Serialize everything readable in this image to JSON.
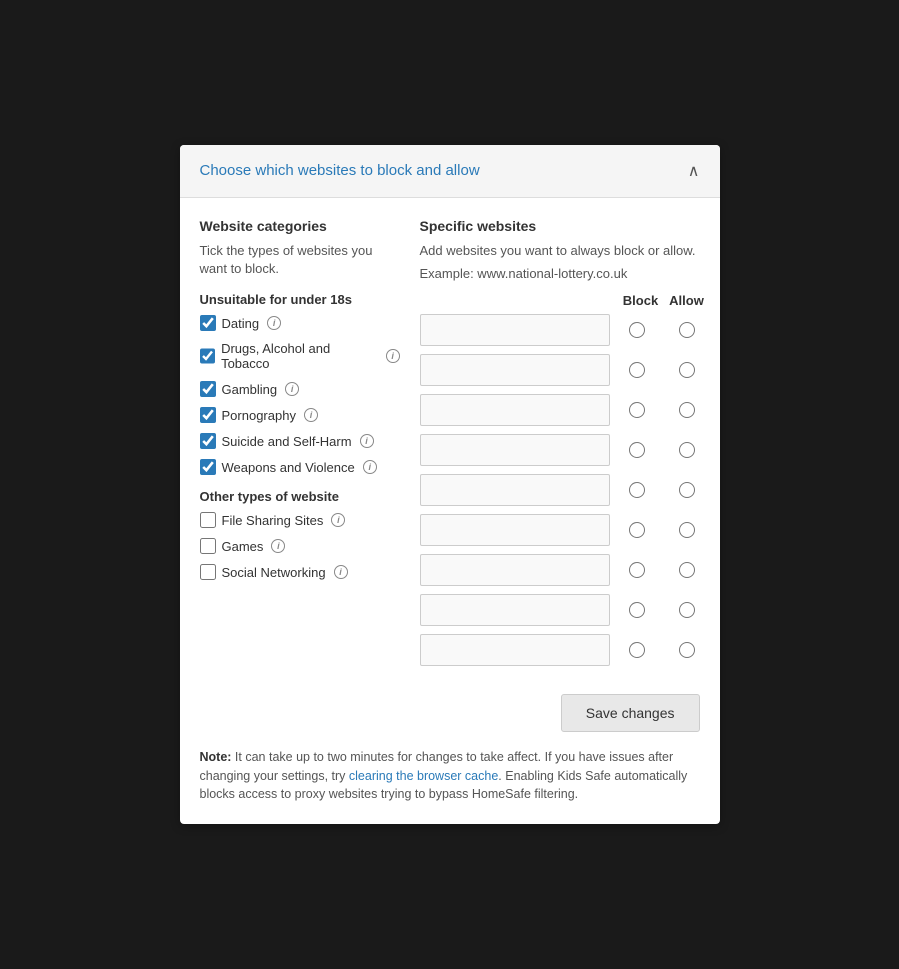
{
  "header": {
    "title": "Choose which websites to block and allow",
    "chevron": "∧"
  },
  "left_col": {
    "section_title": "Website categories",
    "section_desc": "Tick the types of websites you want to block.",
    "group1_title": "Unsuitable for under 18s",
    "group2_title": "Other types of website",
    "categories_under18": [
      {
        "label": "Dating",
        "checked": true
      },
      {
        "label": "Drugs, Alcohol and Tobacco",
        "checked": true
      },
      {
        "label": "Gambling",
        "checked": true
      },
      {
        "label": "Pornography",
        "checked": true
      },
      {
        "label": "Suicide and Self-Harm",
        "checked": true
      },
      {
        "label": "Weapons and Violence",
        "checked": true
      }
    ],
    "categories_other": [
      {
        "label": "File Sharing Sites",
        "checked": false
      },
      {
        "label": "Games",
        "checked": false
      },
      {
        "label": "Social Networking",
        "checked": false
      }
    ]
  },
  "right_col": {
    "title": "Specific websites",
    "desc": "Add websites you want to always block or allow.",
    "example": "Example: www.national-lottery.co.uk",
    "col_block": "Block",
    "col_allow": "Allow",
    "rows": [
      {
        "value": ""
      },
      {
        "value": ""
      },
      {
        "value": ""
      },
      {
        "value": ""
      },
      {
        "value": ""
      },
      {
        "value": ""
      },
      {
        "value": ""
      },
      {
        "value": ""
      },
      {
        "value": ""
      }
    ]
  },
  "footer": {
    "save_btn": "Save changes",
    "note_bold": "Note:",
    "note_text": " It can take up to two minutes for changes to take affect. If you have issues after changing your settings, try ",
    "clearing_link": "clearing the browser cache",
    "note_text2": ". Enabling Kids Safe automatically blocks access to proxy websites trying to bypass HomeSafe filtering."
  }
}
